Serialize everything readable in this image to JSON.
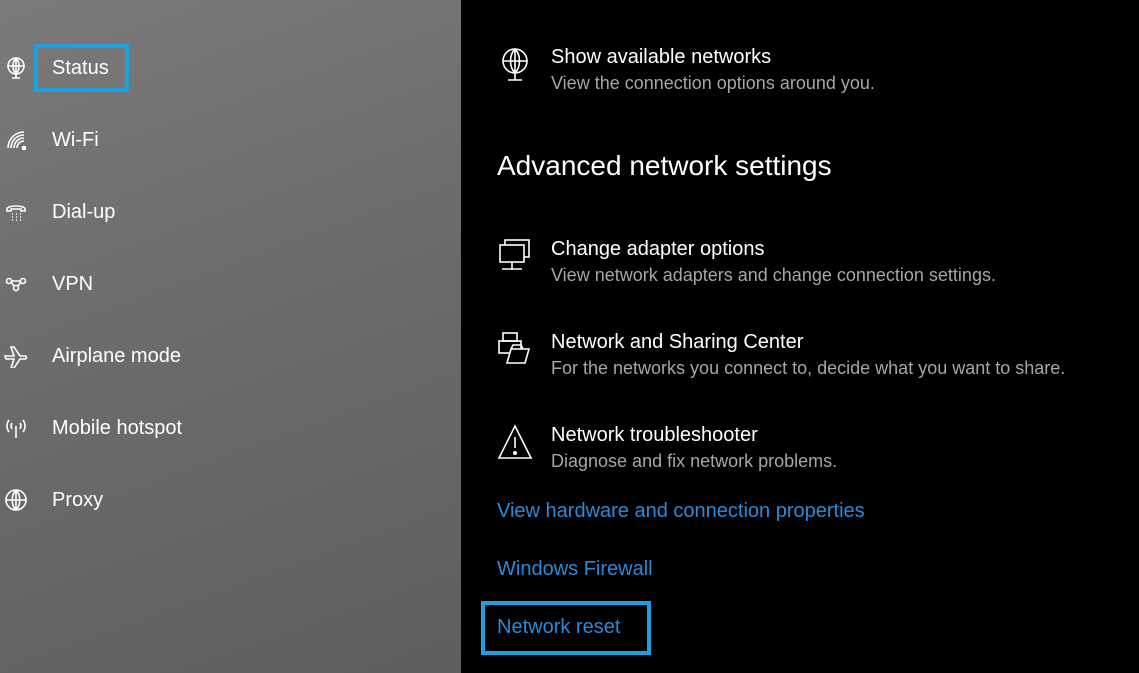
{
  "sidebar": {
    "items": [
      {
        "label": "Status",
        "icon": "status-globe-icon",
        "selected": true
      },
      {
        "label": "Wi-Fi",
        "icon": "wifi-icon"
      },
      {
        "label": "Dial-up",
        "icon": "dialup-phone-icon"
      },
      {
        "label": "VPN",
        "icon": "vpn-icon"
      },
      {
        "label": "Airplane mode",
        "icon": "airplane-icon"
      },
      {
        "label": "Mobile hotspot",
        "icon": "hotspot-icon"
      },
      {
        "label": "Proxy",
        "icon": "globe-icon"
      }
    ]
  },
  "main": {
    "show_networks": {
      "title": "Show available networks",
      "desc": "View the connection options around you."
    },
    "heading": "Advanced network settings",
    "options": [
      {
        "title": "Change adapter options",
        "desc": "View network adapters and change connection settings.",
        "icon": "adapter-icon"
      },
      {
        "title": "Network and Sharing Center",
        "desc": "For the networks you connect to, decide what you want to share.",
        "icon": "sharing-center-icon"
      },
      {
        "title": "Network troubleshooter",
        "desc": "Diagnose and fix network problems.",
        "icon": "warning-icon"
      }
    ],
    "links": [
      "View hardware and connection properties",
      "Windows Firewall",
      "Network reset"
    ]
  },
  "colors": {
    "highlight": "#1ba1e2",
    "link": "#2b8ad8"
  }
}
